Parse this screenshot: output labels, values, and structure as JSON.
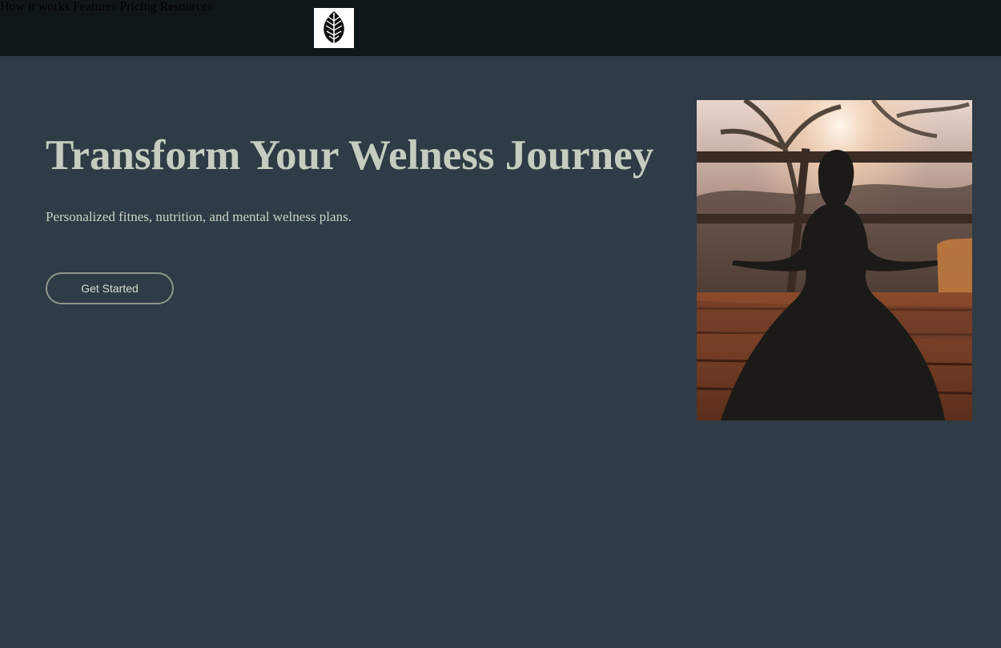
{
  "header": {
    "logo_icon": "leaf-icon",
    "nav": [
      {
        "label": "How it works"
      },
      {
        "label": "Features"
      },
      {
        "label": "Pricing"
      },
      {
        "label": "Resources"
      }
    ]
  },
  "hero": {
    "title": "Transform Your Welness Journey",
    "subtitle": "Personalized fitnes, nutrition, and mental welness plans.",
    "cta_label": "Get Started",
    "image_alt": "person meditating at sunset"
  },
  "colors": {
    "header_bg": "#0f1619",
    "page_bg": "#2f3b45",
    "title_color": "#c5ccc0"
  }
}
